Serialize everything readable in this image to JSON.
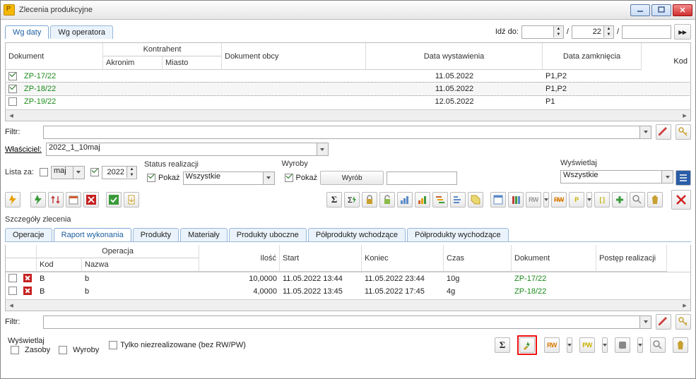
{
  "title": "Zlecenia produkcyjne",
  "main_tabs": [
    "Wg daty",
    "Wg operatora"
  ],
  "goto": {
    "label": "Idź do:",
    "val1": "",
    "val2": "22",
    "val3": ""
  },
  "headers": {
    "dokument": "Dokument",
    "kontrahent": "Kontrahent",
    "akronim": "Akronim",
    "miasto": "Miasto",
    "dok_obcy": "Dokument obcy",
    "data_wyst": "Data wystawienia",
    "data_zamk": "Data zamknięcia",
    "kod": "Kod"
  },
  "rows": [
    {
      "checked": true,
      "doc": "ZP-17/22",
      "data_wyst": "11.05.2022",
      "kod": "P1,P2"
    },
    {
      "checked": true,
      "doc": "ZP-18/22",
      "data_wyst": "11.05.2022",
      "kod": "P1,P2",
      "selected": true
    },
    {
      "checked": false,
      "doc": "ZP-19/22",
      "data_wyst": "12.05.2022",
      "kod": "P1"
    }
  ],
  "filtr_label": "Filtr:",
  "wlasciciel": {
    "label": "Właściciel:",
    "value": "2022_1_10maj"
  },
  "lista_za": {
    "label": "Lista za:",
    "month_checked": false,
    "month": "maj",
    "year_checked": true,
    "year": "2022"
  },
  "status": {
    "label": "Status realizacji",
    "pokaz_checked": true,
    "pokaz": "Pokaż",
    "value": "Wszystkie"
  },
  "wyroby": {
    "label": "Wyroby",
    "pokaz_checked": true,
    "pokaz": "Pokaż",
    "btn": "Wyrób",
    "value": ""
  },
  "wyswietlaj": {
    "label": "Wyświetlaj",
    "value": "Wszystkie"
  },
  "details": {
    "title": "Szczegóły zlecenia",
    "tabs": [
      "Operacje",
      "Raport wykonania",
      "Produkty",
      "Materiały",
      "Produkty uboczne",
      "Półprodukty wchodzące",
      "Półprodukty wychodzące"
    ],
    "headers": {
      "operacja": "Operacja",
      "kod": "Kod",
      "nazwa": "Nazwa",
      "ilosc": "Ilość",
      "start": "Start",
      "koniec": "Koniec",
      "czas": "Czas",
      "dokument": "Dokument",
      "postep": "Postęp realizacji"
    },
    "rows": [
      {
        "kod": "B",
        "nazwa": "b",
        "ilosc": "10,0000",
        "start": "11.05.2022 13:44",
        "koniec": "11.05.2022 23:44",
        "czas": "10g",
        "dok": "ZP-17/22"
      },
      {
        "kod": "B",
        "nazwa": "b",
        "ilosc": "4,0000",
        "start": "11.05.2022 13:45",
        "koniec": "11.05.2022 17:45",
        "czas": "4g",
        "dok": "ZP-18/22"
      }
    ]
  },
  "bottom": {
    "wyswietlaj": "Wyświetlaj",
    "zasoby": "Zasoby",
    "wyroby": "Wyroby",
    "niezreal": "Tylko niezrealizowane (bez RW/PW)"
  }
}
